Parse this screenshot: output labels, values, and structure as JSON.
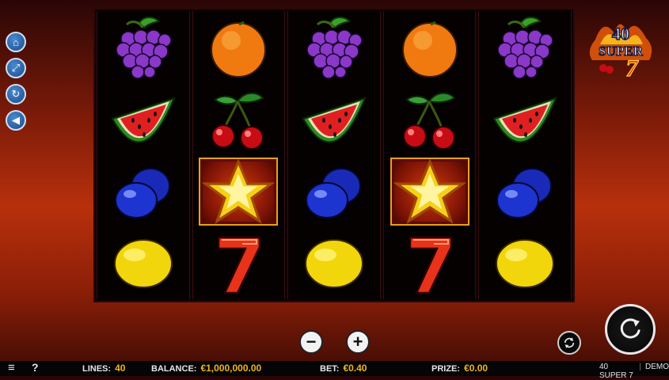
{
  "game": {
    "logo": {
      "number": "40",
      "word": "SUPER",
      "seven": "7"
    },
    "side_buttons": [
      {
        "icon": "home-icon",
        "glyph": "⌂"
      },
      {
        "icon": "fullscreen-icon",
        "glyph": "⤢"
      },
      {
        "icon": "refresh-icon",
        "glyph": "↻"
      },
      {
        "icon": "sound-icon",
        "glyph": "◀"
      }
    ],
    "reels": [
      [
        "grapes",
        "watermelon",
        "plum",
        "lemon"
      ],
      [
        "orange",
        "cherries",
        "star",
        "seven"
      ],
      [
        "grapes",
        "watermelon",
        "plum",
        "lemon"
      ],
      [
        "orange",
        "cherries",
        "star",
        "seven"
      ],
      [
        "grapes",
        "watermelon",
        "plum",
        "lemon"
      ]
    ],
    "controls": {
      "minus": "−",
      "plus": "+"
    }
  },
  "statusbar": {
    "menu_glyph": "≡",
    "help_glyph": "?",
    "lines_label": "LINES:",
    "lines_value": "40",
    "balance_label": "BALANCE:",
    "balance_value": "€1,000,000.00",
    "bet_label": "BET:",
    "bet_value": "€0.40",
    "prize_label": "PRIZE:",
    "prize_value": "€0.00",
    "game_name": "40 SUPER 7",
    "mode": "DEMO"
  },
  "colors": {
    "accent_gold": "#f0b41c",
    "seven_red": "#e8321a",
    "button_blue": "#2a64a8"
  }
}
